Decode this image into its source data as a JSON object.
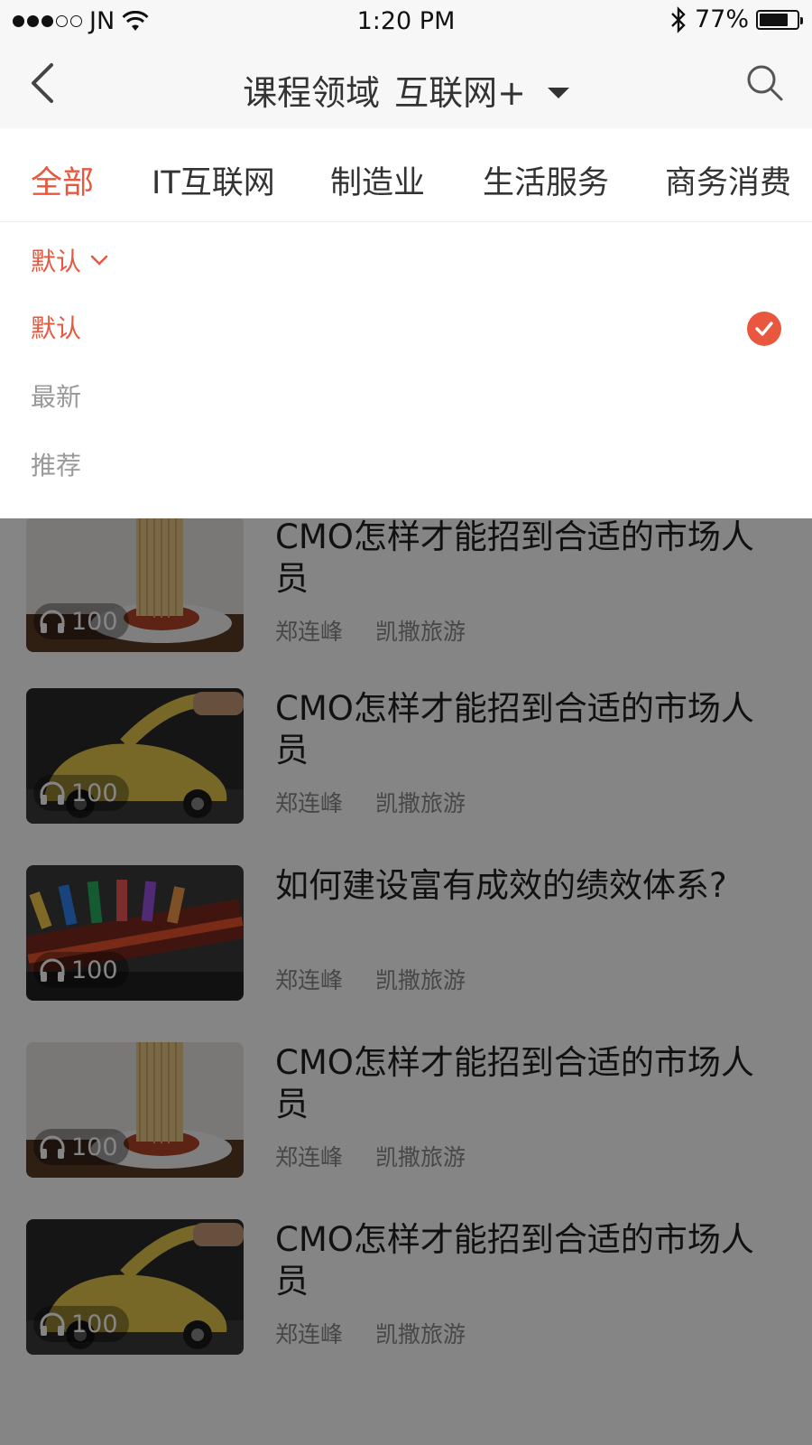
{
  "status_bar": {
    "carrier": "JN",
    "time": "1:20 PM",
    "battery": "77%",
    "battery_level": 0.77
  },
  "nav": {
    "title": "课程领域",
    "domain": "互联网+"
  },
  "tabs": [
    {
      "label": "全部",
      "active": true
    },
    {
      "label": "IT互联网",
      "active": false
    },
    {
      "label": "制造业",
      "active": false
    },
    {
      "label": "生活服务",
      "active": false
    },
    {
      "label": "商务消费",
      "active": false
    }
  ],
  "sort": {
    "header": "默认",
    "options": [
      {
        "label": "默认",
        "selected": true
      },
      {
        "label": "最新",
        "selected": false
      },
      {
        "label": "推荐",
        "selected": false
      }
    ]
  },
  "courses": [
    {
      "title": "CMO怎样才能招到合适的市场人员",
      "plays": "100",
      "author": "郑连峰",
      "org": "凯撒旅游",
      "thumb": "noodles"
    },
    {
      "title": "CMO怎样才能招到合适的市场人员",
      "plays": "100",
      "author": "郑连峰",
      "org": "凯撒旅游",
      "thumb": "car"
    },
    {
      "title": "如何建设富有成效的绩效体系?",
      "plays": "100",
      "author": "郑连峰",
      "org": "凯撒旅游",
      "thumb": "stationery"
    },
    {
      "title": "CMO怎样才能招到合适的市场人员",
      "plays": "100",
      "author": "郑连峰",
      "org": "凯撒旅游",
      "thumb": "noodles"
    },
    {
      "title": "CMO怎样才能招到合适的市场人员",
      "plays": "100",
      "author": "郑连峰",
      "org": "凯撒旅游",
      "thumb": "car"
    }
  ],
  "colors": {
    "accent": "#e8573e",
    "dim_overlay": "rgba(0,0,0,0.48)"
  }
}
